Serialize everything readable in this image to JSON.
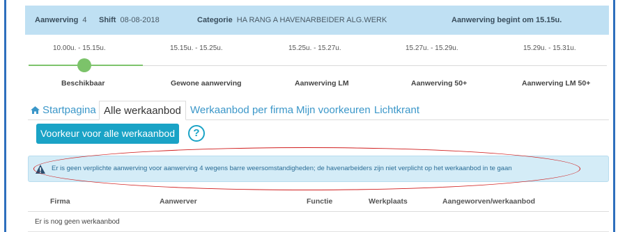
{
  "header": {
    "aanwerving_label": "Aanwerving",
    "aanwerving_value": "4",
    "shift_label": "Shift",
    "shift_value": "08-08-2018",
    "categorie_label": "Categorie",
    "categorie_value": "HA RANG A HAVENARBEIDER ALG.WERK",
    "start_notice": "Aanwerving begint om 15.15u."
  },
  "timeline": {
    "times": [
      "10.00u. - 15.15u.",
      "15.15u. - 15.25u.",
      "15.25u. - 15.27u.",
      "15.27u. - 15.29u.",
      "15.29u. - 15.31u."
    ],
    "phases": [
      "Beschikbaar",
      "Gewone aanwerving",
      "Aanwerving LM",
      "Aanwerving 50+",
      "Aanwerving LM 50+"
    ],
    "active_phase_index": 0,
    "accent_color": "#7cc36a"
  },
  "tabs": [
    {
      "label": "Startpagina",
      "icon": "home-icon"
    },
    {
      "label": "Alle werkaanbod",
      "active": true
    },
    {
      "label": "Werkaanbod per firma"
    },
    {
      "label": "Mijn voorkeuren"
    },
    {
      "label": "Lichtkrant"
    }
  ],
  "actions": {
    "preference_button": "Voorkeur voor alle werkaanbod",
    "help_icon": "?"
  },
  "alert": {
    "icon": "warning-icon",
    "text": "Er is geen verplichte aanwerving voor aanwerving 4 wegens barre weersomstandigheden; de havenarbeiders zijn niet verplicht op het werkaanbod in te gaan"
  },
  "table": {
    "columns": [
      "Firma",
      "Aanwerver",
      "Functie",
      "Werkplaats",
      "Aangeworven/werkaanbod"
    ],
    "empty_message": "Er is nog geen werkaanbod"
  },
  "colors": {
    "header_bg": "#bfe0f3",
    "primary": "#1aa3c6",
    "link": "#3b97c9",
    "alert_bg": "#d4ecf7",
    "annotation": "#d01c1c",
    "frame": "#2e6fbd"
  }
}
